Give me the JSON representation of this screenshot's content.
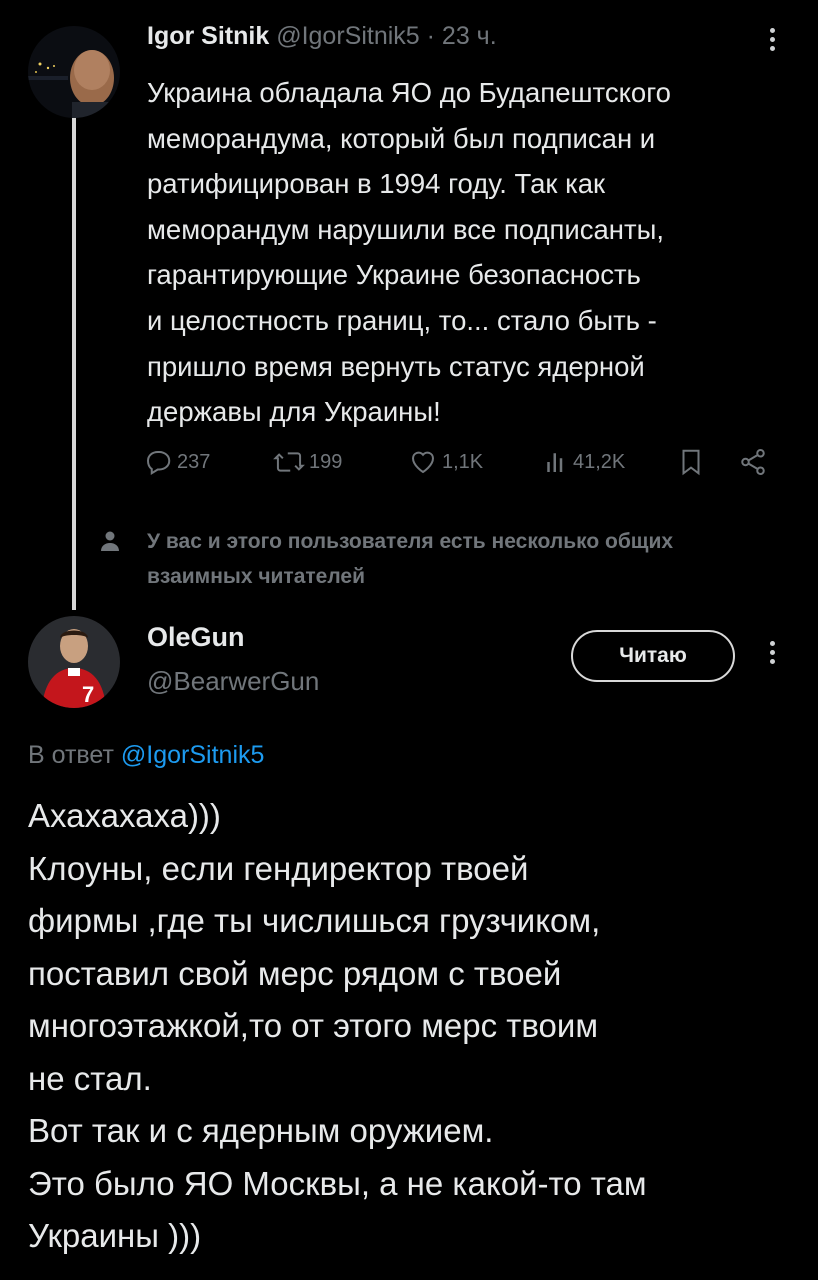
{
  "original_tweet": {
    "author_name": "Igor Sitnik",
    "author_handle": "@IgorSitnik5",
    "separator": "·",
    "time_ago": "23 ч.",
    "text": "Украина обладала ЯО до Будапештского\nмеморандума, который был подписан и\nратифицирован в 1994 году. Так как\nмеморандум нарушили все подписанты,\nгарантирующие Украине безопасность\nи целостность границ, то... стало быть -\nпришло время вернуть статус ядерной\nдержавы для Украины!",
    "metrics": {
      "replies": "237",
      "retweets": "199",
      "likes": "1,1K",
      "views": "41,2K"
    },
    "icons": {
      "avatar": "avatar-icon",
      "more": "more-options-icon",
      "reply": "reply-icon",
      "retweet": "retweet-icon",
      "like": "heart-icon",
      "views": "views-icon",
      "bookmark": "bookmark-icon",
      "share": "share-icon"
    }
  },
  "mutual_followers_note": "У вас и этого пользователя есть несколько общих взаимных читателей",
  "reply_tweet": {
    "author_name": "OleGun",
    "author_handle": "@BearwerGun",
    "follow_button_label": "Читаю",
    "reply_to_prefix": "В ответ",
    "reply_to_mention": "@IgorSitnik5",
    "text": "Ахахахаха)))\nКлоуны, если гендиректор твоей\nфирмы ,где ты числишься грузчиком,\nпоставил свой мерс рядом с твоей\nмногоэтажкой,то от этого мерс твоим\nне стал.\nВот так и с ядерным оружием.\nЭто было ЯО Москвы, а не какой-то там\nУкраины )))"
  },
  "colors": {
    "background": "#000000",
    "text_primary": "#e7e9ea",
    "text_secondary": "#71767b",
    "link": "#1d9bf0"
  }
}
